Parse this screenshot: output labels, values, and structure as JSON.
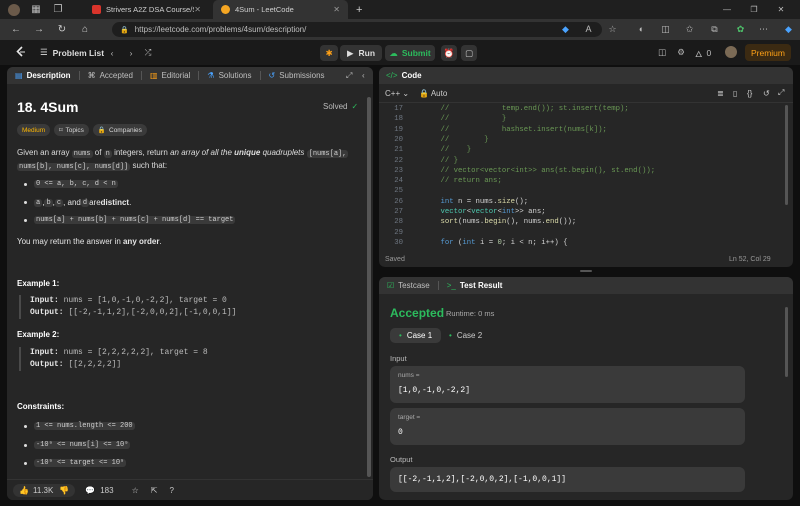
{
  "browser": {
    "tabs": [
      {
        "label": "Strivers A2Z DSA Course/Sheet -",
        "favicon_color": "#d9342b",
        "active": false
      },
      {
        "label": "4Sum - LeetCode",
        "favicon_color": "#f5a623",
        "active": true
      }
    ],
    "url": "https://leetcode.com/problems/4sum/description/"
  },
  "lc_top": {
    "problem_list": "Problem List",
    "run": "Run",
    "submit": "Submit",
    "streak": "0",
    "premium": "Premium"
  },
  "left_tabs": {
    "description": "Description",
    "accepted": "Accepted",
    "editorial": "Editorial",
    "solutions": "Solutions",
    "submissions": "Submissions"
  },
  "problem": {
    "title": "18. 4Sum",
    "solved": "Solved",
    "difficulty": "Medium",
    "topics": "Topics",
    "companies": "Companies",
    "p1_a": "Given an array ",
    "p1_b": "nums",
    "p1_c": " of ",
    "p1_d": "n",
    "p1_e": " integers, return ",
    "p1_f": "an array of all the ",
    "p1_g": "unique",
    "p1_h": " quadruplets ",
    "p1_i": "[nums[a],",
    "p1_j": "nums[b], nums[c], nums[d]]",
    "p1_k": " such that:",
    "b1": "0 <= a, b, c, d < n",
    "b2_a": "a",
    "b2_b": "b",
    "b2_c": "c",
    "b2_and": ", and ",
    "b2_d": "d",
    "b2_e": " are ",
    "b2_f": "distinct",
    "b2_g": ".",
    "b3": "nums[a] + nums[b] + nums[c] + nums[d] == target",
    "p2_a": "You may return the answer in ",
    "p2_b": "any order",
    "p2_c": ".",
    "ex1_title": "Example 1:",
    "ex1_input_label": "Input:",
    "ex1_input": "nums = [1,0,-1,0,-2,2], target = 0",
    "ex1_output_label": "Output:",
    "ex1_output": "[[-2,-1,1,2],[-2,0,0,2],[-1,0,0,1]]",
    "ex2_title": "Example 2:",
    "ex2_input_label": "Input:",
    "ex2_input": "nums = [2,2,2,2,2], target = 8",
    "ex2_output_label": "Output:",
    "ex2_output": "[[2,2,2,2]]",
    "constraints_title": "Constraints:",
    "c1": "1 <= nums.length <= 200",
    "c2": "-10⁹ <= nums[i] <= 10⁹",
    "c3": "-10⁹ <= target <= 10⁹",
    "likes": "11.3K",
    "comments": "183"
  },
  "code": {
    "title": "Code",
    "language": "C++",
    "auto": "Auto",
    "status": "Saved",
    "cursor": "Ln 52, Col 29",
    "lines": [
      {
        "n": "17",
        "segs": [
          [
            "cm",
            "    //            temp.end()); st.insert(temp);"
          ]
        ]
      },
      {
        "n": "18",
        "segs": [
          [
            "cm",
            "    //            }"
          ]
        ]
      },
      {
        "n": "19",
        "segs": [
          [
            "cm",
            "    //            hashset.insert(nums[k]);"
          ]
        ]
      },
      {
        "n": "20",
        "segs": [
          [
            "cm",
            "    //        }"
          ]
        ]
      },
      {
        "n": "21",
        "segs": [
          [
            "cm",
            "    //    }"
          ]
        ]
      },
      {
        "n": "22",
        "segs": [
          [
            "cm",
            "    // }"
          ]
        ]
      },
      {
        "n": "23",
        "segs": [
          [
            "cm",
            "    // vector<vector<int>> ans(st.begin(), st.end());"
          ]
        ]
      },
      {
        "n": "24",
        "segs": [
          [
            "cm",
            "    // return ans;"
          ]
        ]
      },
      {
        "n": "25",
        "segs": []
      },
      {
        "n": "26",
        "segs": [
          [
            "pl",
            "    "
          ],
          [
            "kw",
            "int"
          ],
          [
            "pl",
            " n = nums."
          ],
          [
            "fn",
            "size"
          ],
          [
            "pl",
            "();"
          ]
        ]
      },
      {
        "n": "27",
        "segs": [
          [
            "pl",
            "    "
          ],
          [
            "ty",
            "vector"
          ],
          [
            "pl",
            "<"
          ],
          [
            "ty",
            "vector"
          ],
          [
            "pl",
            "<"
          ],
          [
            "kw",
            "int"
          ],
          [
            "pl",
            ">> ans;"
          ]
        ]
      },
      {
        "n": "28",
        "segs": [
          [
            "pl",
            "    "
          ],
          [
            "fn",
            "sort"
          ],
          [
            "pl",
            "(nums."
          ],
          [
            "fn",
            "begin"
          ],
          [
            "pl",
            "(), nums."
          ],
          [
            "fn",
            "end"
          ],
          [
            "pl",
            "());"
          ]
        ]
      },
      {
        "n": "29",
        "segs": []
      },
      {
        "n": "30",
        "segs": [
          [
            "pl",
            "    "
          ],
          [
            "kw",
            "for"
          ],
          [
            "pl",
            " ("
          ],
          [
            "kw",
            "int"
          ],
          [
            "pl",
            " i = "
          ],
          [
            "nm",
            "0"
          ],
          [
            "pl",
            "; i < n; i++) {"
          ]
        ]
      }
    ]
  },
  "result": {
    "testcase_tab": "Testcase",
    "result_tab": "Test Result",
    "verdict": "Accepted",
    "runtime": "Runtime: 0 ms",
    "case1": "Case 1",
    "case2": "Case 2",
    "input_label": "Input",
    "nums_label": "nums =",
    "nums_value": "[1,0,-1,0,-2,2]",
    "target_label": "target =",
    "target_value": "0",
    "output_label": "Output",
    "output_value": "[[-2,-1,1,2],[-2,0,0,2],[-1,0,0,1]]"
  },
  "colors": {
    "accepted": "#2cbb5d",
    "medium": "#ffb800",
    "premium": "#ffa116"
  }
}
